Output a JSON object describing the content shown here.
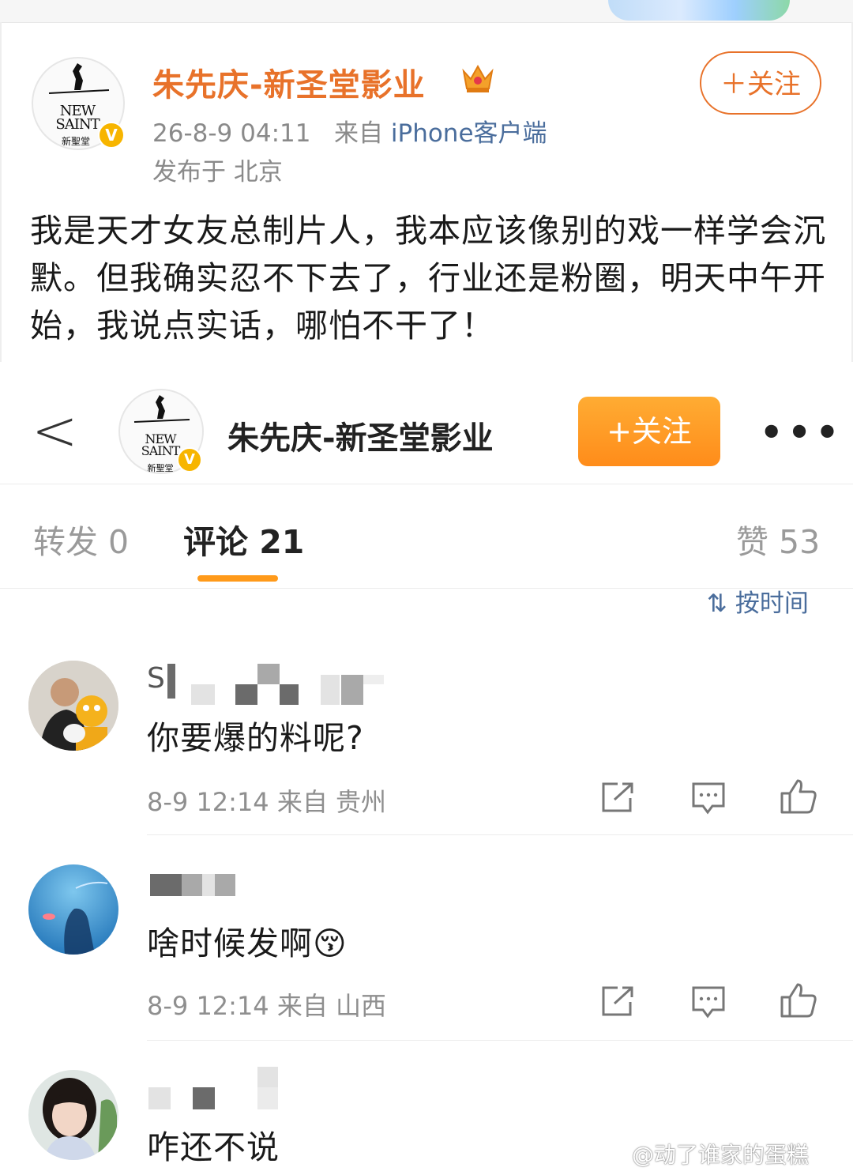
{
  "post": {
    "author": "朱先庆-新圣堂影业",
    "timestamp": "26-8-9 04:11",
    "source_prefix": "来自",
    "source": "iPhone客户端",
    "location": "发布于 北京",
    "follow_label": "＋关注",
    "body": "我是天才女友总制片人，我本应该像别的戏一样学会沉默。但我确实忍不下去了，行业还是粉圈，明天中午开始，我说点实话，哪怕不干了！",
    "logo_line1": "NEW",
    "logo_line2": "SAINT",
    "logo_sub": "新聖堂",
    "verified_icon": "verified-v-icon",
    "crown_icon": "crown-icon"
  },
  "header": {
    "back_glyph": "<",
    "name": "朱先庆-新圣堂影业",
    "follow_label": "+关注",
    "more_glyph": "•••"
  },
  "tabs": {
    "repost": "转发 0",
    "comment": "评论 21",
    "like": "赞 53"
  },
  "sort_label": "⇅ 按时间",
  "comments": [
    {
      "name_visible": "S",
      "text": "你要爆的料呢?",
      "meta": "8-9 12:14 来自 贵州"
    },
    {
      "name_visible": "",
      "text": "啥时候发啊😚",
      "meta": "8-9 12:14 来自 山西"
    },
    {
      "name_visible": "",
      "text": "咋还不说",
      "meta": ""
    }
  ],
  "actions": [
    "share-icon",
    "comment-icon",
    "like-icon"
  ],
  "watermark": "@动了谁家的蛋糕",
  "colors": {
    "accent_orange": "#e8722a",
    "follow_button": "#ff9a1a",
    "link_blue": "#4a6d9c",
    "meta_gray": "#8a8a8a"
  }
}
